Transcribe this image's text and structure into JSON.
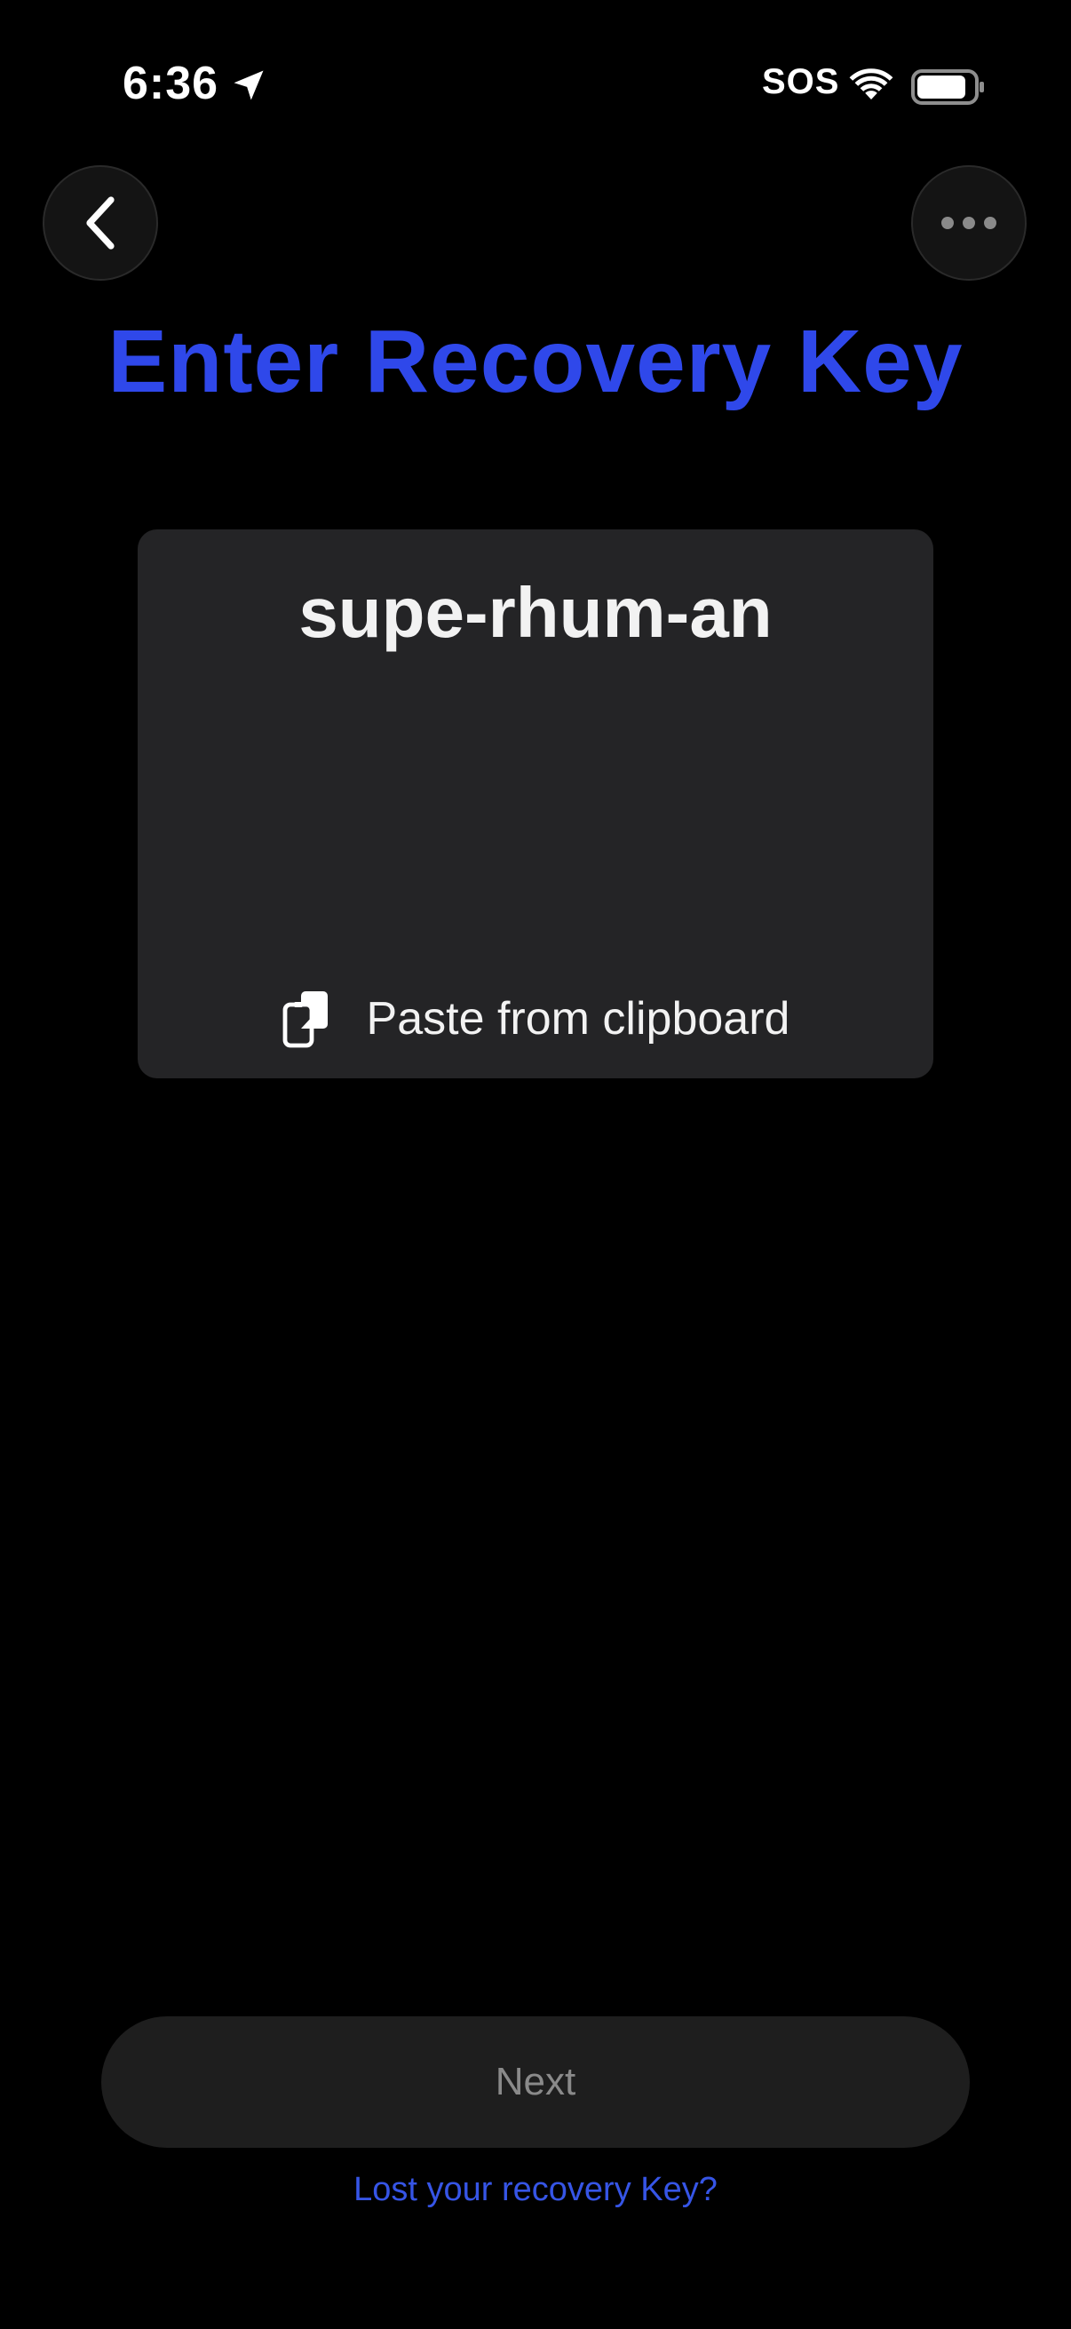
{
  "status_bar": {
    "time": "6:36",
    "carrier": "SOS",
    "icons": [
      "location-arrow-icon",
      "wifi-icon",
      "battery-icon"
    ]
  },
  "nav": {
    "back_icon": "chevron-left-icon",
    "more_icon": "ellipsis-icon"
  },
  "page": {
    "title": "Enter Recovery Key"
  },
  "key_card": {
    "value": "supe-rhum-an",
    "paste_label": "Paste from clipboard",
    "paste_icon": "clipboard-icon"
  },
  "actions": {
    "next_label": "Next",
    "lost_key_label": "Lost your recovery Key?"
  },
  "colors": {
    "accent": "#2f48ea",
    "link": "#3655e6",
    "card": "#242426",
    "background": "#000000"
  }
}
